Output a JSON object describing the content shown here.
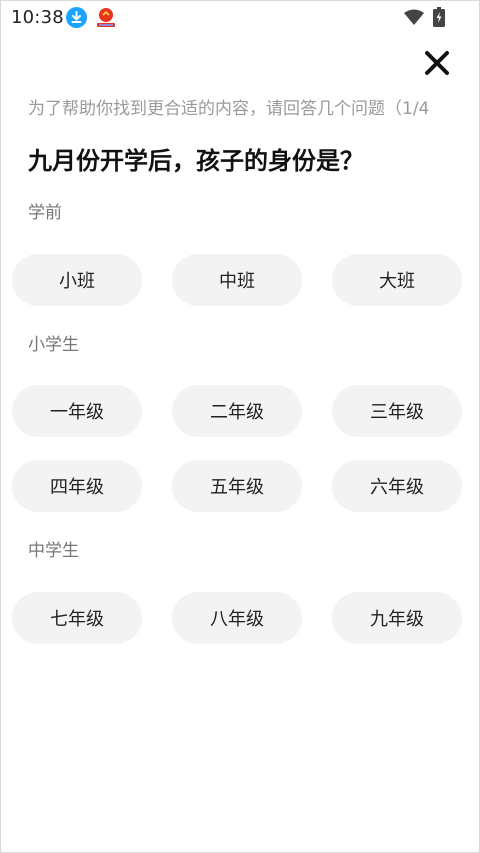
{
  "status_bar": {
    "time": "10:38",
    "icons": [
      "download-icon",
      "app-notification-icon",
      "wifi-icon",
      "battery-charging-icon"
    ]
  },
  "header": {
    "close_icon": "close-icon",
    "subtitle": "为了帮助你找到更合适的内容，请回答几个问题（1/4",
    "question": "九月份开学后，孩子的身份是？"
  },
  "sections": [
    {
      "label": "学前",
      "options": [
        "小班",
        "中班",
        "大班"
      ]
    },
    {
      "label": "小学生",
      "options": [
        "一年级",
        "二年级",
        "三年级",
        "四年级",
        "五年级",
        "六年级"
      ]
    },
    {
      "label": "中学生",
      "options": [
        "七年级",
        "八年级",
        "九年级"
      ]
    }
  ],
  "colors": {
    "option_background": "#f3f3f3",
    "download_badge": "#1aa3ff",
    "subtitle_text": "#9a9a9a"
  }
}
